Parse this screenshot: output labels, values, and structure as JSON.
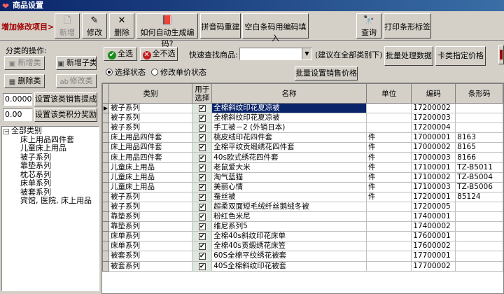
{
  "window": {
    "title": "商品设置"
  },
  "toolbar": {
    "section_label": "增加修改项目>",
    "buttons": [
      {
        "label": "新增",
        "icon": "new-doc-icon",
        "disabled": true
      },
      {
        "label": "修改",
        "icon": "edit-icon",
        "disabled": false
      },
      {
        "label": "删除",
        "icon": "delete-x-icon",
        "disabled": false
      },
      {
        "label": "如何自动生成编码?",
        "icon": "book-icon",
        "disabled": false
      },
      {
        "label": "拼音码重建",
        "disabled": false
      },
      {
        "label": "空白条码用编码填入",
        "disabled": false
      },
      {
        "label": "查询",
        "icon": "search-binoculars-icon",
        "disabled": false
      },
      {
        "label": "打印条形标签",
        "disabled": false
      }
    ]
  },
  "category_ops": {
    "label": "分类的操作:",
    "add_category": "新增类",
    "add_subcategory": "新增子类",
    "delete_category": "删除类",
    "edit_category": "修改类",
    "sales_commission_value": "0.0000",
    "sales_commission_button": "设置该类销售提成",
    "points_reward_value": "0.00",
    "points_reward_button": "设置该类积分奖励"
  },
  "tree": {
    "root": "全部类别",
    "children": [
      "床上用品四件套",
      "儿童床上用品",
      "被子系列",
      "靠垫系列",
      "枕芯系列",
      "床单系列",
      "被套系列",
      "宾馆, 医院, 床上用品"
    ]
  },
  "actions": {
    "select_all": "全选",
    "select_none": "全不选",
    "quick_search_label": "快速查找商品:",
    "quick_search_value": "",
    "search_hint": "(建议在全部类别下)",
    "batch_process": "批量处理数据",
    "card_price": "卡类指定价格",
    "batch_sale_price": "批量设置销售价格",
    "radio_select_state": "选择状态",
    "radio_edit_price": "修改单价状态"
  },
  "grid": {
    "columns": [
      "类别",
      "用于选择",
      "名称",
      "单位",
      "编码",
      "条形码"
    ],
    "rows": [
      {
        "category": "被子系列",
        "checked": true,
        "name": "全棉斜纹印花夏凉被",
        "unit": "",
        "code": "17200002",
        "barcode": "",
        "selected": true
      },
      {
        "category": "被子系列",
        "checked": true,
        "name": "全棉斜纹印花夏凉被",
        "unit": "",
        "code": "17200003",
        "barcode": ""
      },
      {
        "category": "被子系列",
        "checked": true,
        "name": "手工被－2 (外销日本)",
        "unit": "",
        "code": "17200004",
        "barcode": ""
      },
      {
        "category": "床上用品四件套",
        "checked": true,
        "name": "桃皮绒印花四件套",
        "unit": "件",
        "code": "17000001",
        "barcode": "8163"
      },
      {
        "category": "床上用品四件套",
        "checked": true,
        "name": "全棉平纹贡缎绣花四件套",
        "unit": "件",
        "code": "17000002",
        "barcode": "8165"
      },
      {
        "category": "床上用品四件套",
        "checked": true,
        "name": "40s欧式绣花四件套",
        "unit": "件",
        "code": "17000003",
        "barcode": "8166"
      },
      {
        "category": "儿童床上用品",
        "checked": true,
        "name": "老鼠爱大米",
        "unit": "件",
        "code": "17100001",
        "barcode": "TZ-B5011"
      },
      {
        "category": "儿童床上用品",
        "checked": true,
        "name": "淘气蓝猫",
        "unit": "件",
        "code": "17100002",
        "barcode": "TZ-B5004"
      },
      {
        "category": "儿童床上用品",
        "checked": true,
        "name": "美丽心情",
        "unit": "件",
        "code": "17100003",
        "barcode": "TZ-B5006"
      },
      {
        "category": "被子系列",
        "checked": true,
        "name": "蚕丝被",
        "unit": "件",
        "code": "17200001",
        "barcode": "85124"
      },
      {
        "category": "被子系列",
        "checked": true,
        "name": "超柔双面短毛绒纤丝鹅绒冬被",
        "unit": "",
        "code": "17200005",
        "barcode": ""
      },
      {
        "category": "靠垫系列",
        "checked": true,
        "name": "粉红色米尼",
        "unit": "",
        "code": "17400001",
        "barcode": ""
      },
      {
        "category": "靠垫系列",
        "checked": true,
        "name": "维尼系列5",
        "unit": "",
        "code": "17400002",
        "barcode": ""
      },
      {
        "category": "床单系列",
        "checked": true,
        "name": "全棉40s斜纹印花床单",
        "unit": "",
        "code": "17600001",
        "barcode": ""
      },
      {
        "category": "床单系列",
        "checked": true,
        "name": "全棉40s贡缎绣花床笠",
        "unit": "",
        "code": "17600002",
        "barcode": ""
      },
      {
        "category": "被套系列",
        "checked": true,
        "name": "60S全棉平纹绣花被套",
        "unit": "",
        "code": "17700001",
        "barcode": ""
      },
      {
        "category": "被套系列",
        "checked": true,
        "name": "40S全棉斜纹印花被套",
        "unit": "",
        "code": "17700002",
        "barcode": ""
      }
    ]
  }
}
